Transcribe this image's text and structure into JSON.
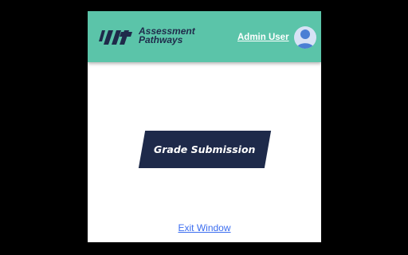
{
  "colors": {
    "accent": "#5bc4a9",
    "button": "#1e2a4a",
    "link": "#3b6df0"
  },
  "header": {
    "logo_icon": "ap-logo-icon",
    "brand_line1": "Assessment",
    "brand_line2": "Pathways",
    "user_name": "Admin User",
    "avatar_icon": "user-avatar-icon"
  },
  "main": {
    "grade_button_label": "Grade Submission",
    "exit_link_label": "Exit Window"
  }
}
